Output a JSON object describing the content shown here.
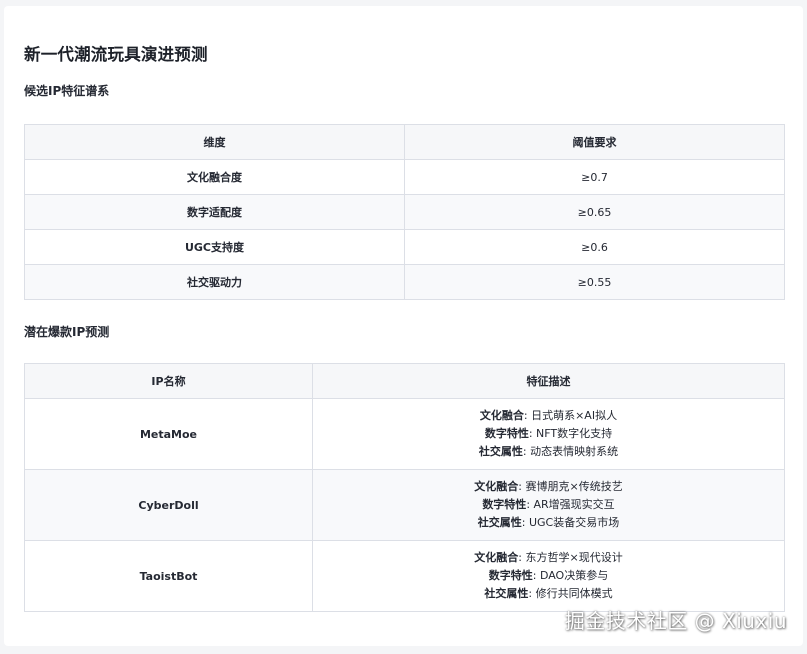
{
  "title": "新一代潮流玩具演进预测",
  "section1": {
    "heading": "候选IP特征谱系",
    "headers": [
      "维度",
      "阈值要求"
    ],
    "rows": [
      {
        "dimension": "文化融合度",
        "threshold": "≥0.7"
      },
      {
        "dimension": "数字适配度",
        "threshold": "≥0.65"
      },
      {
        "dimension": "UGC支持度",
        "threshold": "≥0.6"
      },
      {
        "dimension": "社交驱动力",
        "threshold": "≥0.55"
      }
    ]
  },
  "section2": {
    "heading": "潜在爆款IP预测",
    "headers": [
      "IP名称",
      "特征描述"
    ],
    "rows": [
      {
        "name": "MetaMoe",
        "features": [
          {
            "label": "文化融合",
            "text": ": 日式萌系×AI拟人"
          },
          {
            "label": "数字特性",
            "text": ": NFT数字化支持"
          },
          {
            "label": "社交属性",
            "text": ": 动态表情映射系统"
          }
        ]
      },
      {
        "name": "CyberDoll",
        "features": [
          {
            "label": "文化融合",
            "text": ": 赛博朋克×传统技艺"
          },
          {
            "label": "数字特性",
            "text": ": AR增强现实交互"
          },
          {
            "label": "社交属性",
            "text": ": UGC装备交易市场"
          }
        ]
      },
      {
        "name": "TaoistBot",
        "features": [
          {
            "label": "文化融合",
            "text": ": 东方哲学×现代设计"
          },
          {
            "label": "数字特性",
            "text": ": DAO决策参与"
          },
          {
            "label": "社交属性",
            "text": ": 修行共同体模式"
          }
        ]
      }
    ]
  },
  "watermark": "掘金技术社区 @ Xiuxiu"
}
